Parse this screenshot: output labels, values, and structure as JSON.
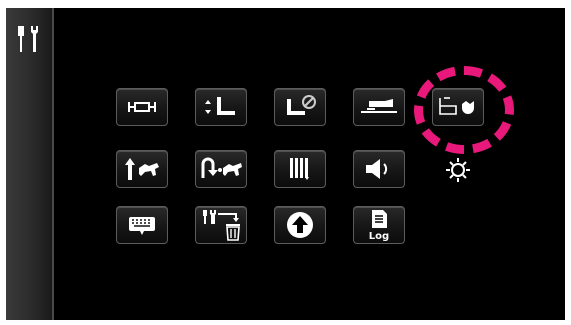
{
  "sidebar": {
    "icon": "settings-icon"
  },
  "grid": {
    "rows": [
      [
        "buttonhole-icon",
        "presser-foot-up-down-icon",
        "presser-foot-lock-icon",
        "feed-dog-icon",
        "sewing-light-icon"
      ],
      [
        "up-speed-icon",
        "needle-up-down-speed-icon",
        "thread-tension-icon",
        "sound-icon",
        "screen-brightness-icon"
      ],
      [
        "keyboard-icon",
        "delete-settings-icon",
        "update-icon",
        "log-icon"
      ]
    ],
    "log_label": "Log"
  },
  "highlight": {
    "color": "#e8197a",
    "target": "sewing-light-icon"
  },
  "colors": {
    "screen": "#000000",
    "icon": "#ffffff",
    "button_border": "#5c5c5c"
  }
}
